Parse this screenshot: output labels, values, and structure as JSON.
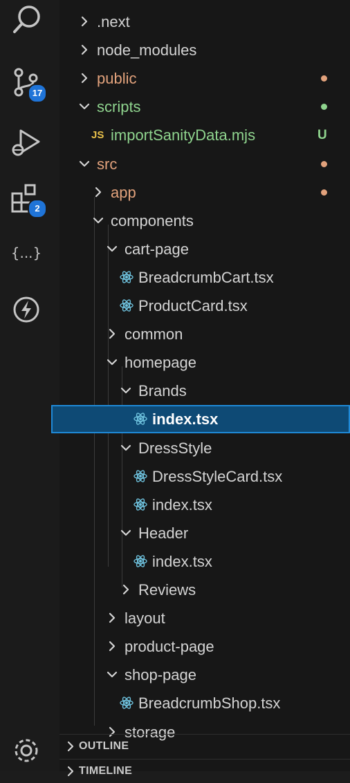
{
  "colors": {
    "folder": "#d4d4d4",
    "modified": "#e2a27c",
    "untracked": "#8fd48e",
    "selected_bg": "#0e4a75",
    "selected_border": "#1f8ad8",
    "badge": "#1f74d8"
  },
  "activity_bar": {
    "items": [
      {
        "name": "search-icon"
      },
      {
        "name": "source-control-icon",
        "badge": "17"
      },
      {
        "name": "run-debug-icon"
      },
      {
        "name": "extensions-icon",
        "badge": "2"
      },
      {
        "name": "json-braces-icon"
      },
      {
        "name": "lightning-icon"
      },
      {
        "name": "settings-gear-icon"
      }
    ]
  },
  "explorer": {
    "items": [
      {
        "label": ".next",
        "type": "folder",
        "expanded": false,
        "status": ""
      },
      {
        "label": "node_modules",
        "type": "folder",
        "expanded": false,
        "status": ""
      },
      {
        "label": "public",
        "type": "folder",
        "expanded": false,
        "status": "modified"
      },
      {
        "label": "scripts",
        "type": "folder",
        "expanded": true,
        "status": "untracked"
      },
      {
        "label": "importSanityData.mjs",
        "type": "js",
        "icon": "JS",
        "status": "untracked",
        "badge": "U"
      },
      {
        "label": "src",
        "type": "folder",
        "expanded": true,
        "status": "modified"
      },
      {
        "label": "app",
        "type": "folder",
        "expanded": false,
        "status": "modified"
      },
      {
        "label": "components",
        "type": "folder",
        "expanded": true,
        "status": ""
      },
      {
        "label": "cart-page",
        "type": "folder",
        "expanded": true,
        "status": ""
      },
      {
        "label": "BreadcrumbCart.tsx",
        "type": "tsx",
        "status": ""
      },
      {
        "label": "ProductCard.tsx",
        "type": "tsx",
        "status": ""
      },
      {
        "label": "common",
        "type": "folder",
        "expanded": false,
        "status": ""
      },
      {
        "label": "homepage",
        "type": "folder",
        "expanded": true,
        "status": ""
      },
      {
        "label": "Brands",
        "type": "folder",
        "expanded": true,
        "status": ""
      },
      {
        "label": "index.tsx",
        "type": "tsx",
        "status": "",
        "selected": true
      },
      {
        "label": "DressStyle",
        "type": "folder",
        "expanded": true,
        "status": ""
      },
      {
        "label": "DressStyleCard.tsx",
        "type": "tsx",
        "status": ""
      },
      {
        "label": "index.tsx",
        "type": "tsx",
        "status": ""
      },
      {
        "label": "Header",
        "type": "folder",
        "expanded": true,
        "status": ""
      },
      {
        "label": "index.tsx",
        "type": "tsx",
        "status": ""
      },
      {
        "label": "Reviews",
        "type": "folder",
        "expanded": false,
        "status": ""
      },
      {
        "label": "layout",
        "type": "folder",
        "expanded": false,
        "status": ""
      },
      {
        "label": "product-page",
        "type": "folder",
        "expanded": false,
        "status": ""
      },
      {
        "label": "shop-page",
        "type": "folder",
        "expanded": true,
        "status": ""
      },
      {
        "label": "BreadcrumbShop.tsx",
        "type": "tsx",
        "status": ""
      },
      {
        "label": "storage",
        "type": "folder",
        "expanded": false,
        "status": ""
      }
    ],
    "sections": [
      {
        "label": "OUTLINE"
      },
      {
        "label": "TIMELINE"
      }
    ]
  }
}
